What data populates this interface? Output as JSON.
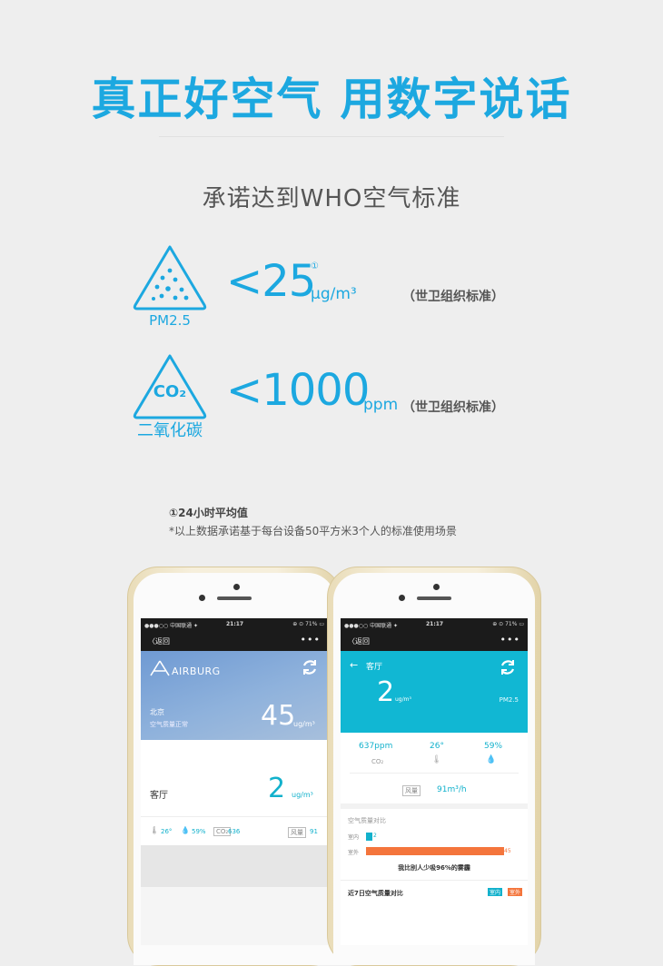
{
  "title": "真正好空气 用数字说话",
  "subtitle": "承诺达到WHO空气标准",
  "pm25": {
    "icon_label": "PM2.5",
    "value": "<25",
    "sup": "①",
    "unit": "μg/m³",
    "note": "（世卫组织标准）"
  },
  "co2": {
    "icon_text": "CO₂",
    "icon_label": "二氧化碳",
    "value": "<1000",
    "unit": "ppm",
    "note": "（世卫组织标准）"
  },
  "footnote1": "①24小时平均值",
  "footnote2": "*以上数据承诺基于每台设备50平方米3个人的标准使用场景",
  "phone_left": {
    "status": {
      "carrier": "●●●○○ 中国联通 ✦",
      "time": "21:17",
      "battery": "⊕ ⊙ 71% ▭"
    },
    "nav": {
      "back": "〈返回",
      "more": "•••"
    },
    "brand": "AIRBURG",
    "city": "北京",
    "city_status": "空气质量正常",
    "outdoor_value": "45",
    "outdoor_unit": "ug/m³",
    "room": "客厅",
    "room_value": "2",
    "room_unit": "ug/m³",
    "temp": "26°",
    "humidity": "59%",
    "co2_badge": "CO₂",
    "co2": "636",
    "wind_badge": "风量",
    "wind": "91"
  },
  "phone_right": {
    "status": {
      "carrier": "●●●○○ 中国联通 ✦",
      "time": "21:17",
      "battery": "⊕ ⊙ 71% ▭"
    },
    "nav": {
      "back": "〈返回",
      "more": "•••"
    },
    "room": "客厅",
    "value": "2",
    "unit": "ug/m³",
    "metric": "PM2.5",
    "co2": "637ppm",
    "co2_label": "CO₂",
    "temp": "26°",
    "humidity": "59%",
    "wind_badge": "风量",
    "wind": "91m³/h",
    "compare_title": "空气质量对比",
    "indoor_label": "室内",
    "indoor_value": "2",
    "outdoor_label": "室外",
    "outdoor_value": "45",
    "indoor_fraction": 0.044,
    "outdoor_fraction": 1.0,
    "compare_text": "我比别人少吸96%的雾霾",
    "week_title": "近7日空气质量对比",
    "week_tag_in": "室内",
    "week_tag_out": "室外"
  },
  "colors": {
    "accent": "#1ca8e0",
    "cyan_header": "#11b7d3",
    "orange": "#f4753c"
  }
}
